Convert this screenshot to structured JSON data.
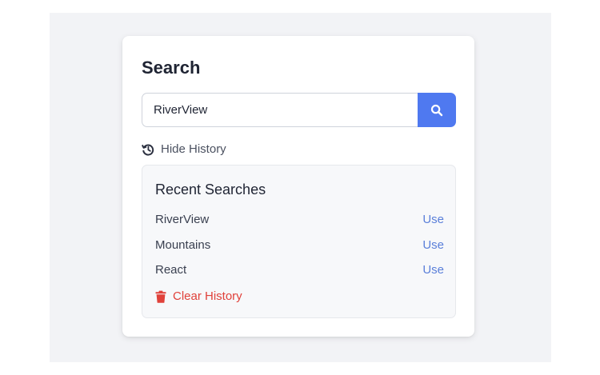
{
  "search": {
    "title": "Search",
    "value": "RiverView",
    "button_icon": "search-icon"
  },
  "history_toggle": {
    "icon": "history-icon",
    "label": "Hide History"
  },
  "history": {
    "heading": "Recent Searches",
    "items": [
      {
        "term": "RiverView",
        "action": "Use"
      },
      {
        "term": "Mountains",
        "action": "Use"
      },
      {
        "term": "React",
        "action": "Use"
      }
    ],
    "clear_icon": "trash-icon",
    "clear_label": "Clear History"
  },
  "colors": {
    "accent": "#4f79f0",
    "link": "#5a7fd9",
    "danger": "#e0413a",
    "background": "#f2f3f6"
  }
}
